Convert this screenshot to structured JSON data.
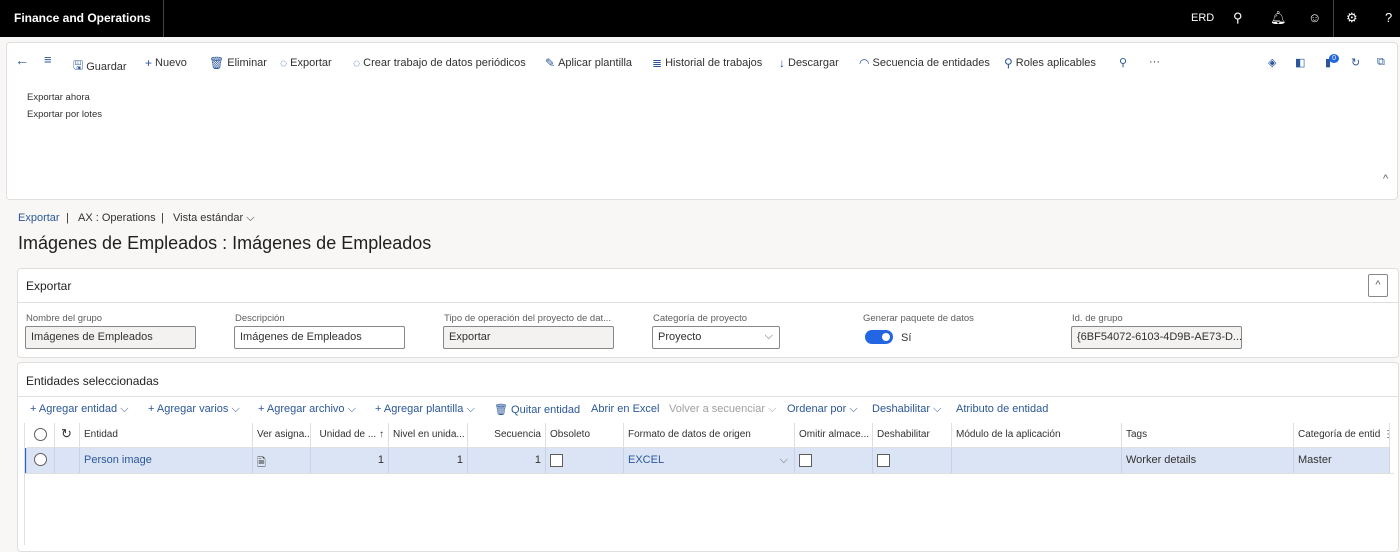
{
  "app": {
    "title": "Finance and Operations",
    "company": "ERD",
    "icons": [
      "search-icon",
      "bell-icon",
      "smiley-icon",
      "gear-icon",
      "help-icon"
    ]
  },
  "actions": [
    {
      "icon": "save-icon",
      "glyph": "🖫",
      "label": "Guardar"
    },
    {
      "icon": "plus-icon",
      "glyph": "+",
      "label": "Nuevo"
    },
    {
      "icon": "trash-icon",
      "glyph": "🗑",
      "label": "Eliminar"
    },
    {
      "icon": "export-icon",
      "glyph": "◌",
      "label": "Exportar"
    },
    {
      "icon": "recurring-icon",
      "glyph": "◌",
      "label": "Crear trabajo de datos periódicos"
    },
    {
      "icon": "pencil-icon",
      "glyph": "✎",
      "label": "Aplicar plantilla"
    },
    {
      "icon": "list-icon",
      "glyph": "≣",
      "label": "Historial de trabajos"
    },
    {
      "icon": "download-icon",
      "glyph": "↓",
      "label": "Descargar"
    },
    {
      "icon": "sequence-icon",
      "glyph": "◠",
      "label": "Secuencia de entidades"
    },
    {
      "icon": "roles-icon",
      "glyph": "⚲",
      "label": "Roles aplicables"
    }
  ],
  "export_menu": [
    "Exportar ahora",
    "Exportar por lotes"
  ],
  "notification_count": "0",
  "breadcrumb": {
    "link": "Exportar",
    "company": "AX : Operations",
    "view": "Vista estándar"
  },
  "page_title": "Imágenes de Empleados : Imágenes de Empleados",
  "export_section": {
    "title": "Exportar",
    "fields": {
      "group_name": {
        "label": "Nombre del grupo",
        "value": "Imágenes de Empleados"
      },
      "description": {
        "label": "Descripción",
        "value": "Imágenes de Empleados"
      },
      "operation_type": {
        "label": "Tipo de operación del proyecto de dat...",
        "value": "Exportar"
      },
      "project_category": {
        "label": "Categoría de proyecto",
        "value": "Proyecto"
      },
      "generate_package": {
        "label": "Generar paquete de datos",
        "value": "Sí",
        "on": true
      },
      "group_id": {
        "label": "Id. de grupo",
        "value": "{6BF54072-6103-4D9B-AE73-D..."
      }
    }
  },
  "entities_section": {
    "title": "Entidades seleccionadas",
    "toolbar": [
      "Agregar entidad",
      "Agregar varios",
      "Agregar archivo",
      "Agregar plantilla",
      "Quitar entidad",
      "Abrir en Excel",
      "Volver a secuenciar",
      "Ordenar por",
      "Deshabilitar",
      "Atributo de entidad"
    ],
    "columns": [
      "Entidad",
      "Ver asigna...",
      "Unidad de ...",
      "Nivel en unida...",
      "Secuencia",
      "Obsoleto",
      "Formato de datos de origen",
      "Omitir almace...",
      "Deshabilitar",
      "Módulo de la aplicación",
      "Tags",
      "Categoría de entid"
    ],
    "rows": [
      {
        "entity": "Person image",
        "unit": "1",
        "level": "1",
        "sequence": "1",
        "obsolete": false,
        "format": "EXCEL",
        "skip_staging": false,
        "disabled": false,
        "module": "",
        "tags": "Worker details",
        "category": "Master"
      }
    ]
  },
  "colors": {
    "accent": "#2b579a",
    "toggle": "#2266e3",
    "selected_row": "#dbe4f5",
    "topbar": "#000000"
  }
}
